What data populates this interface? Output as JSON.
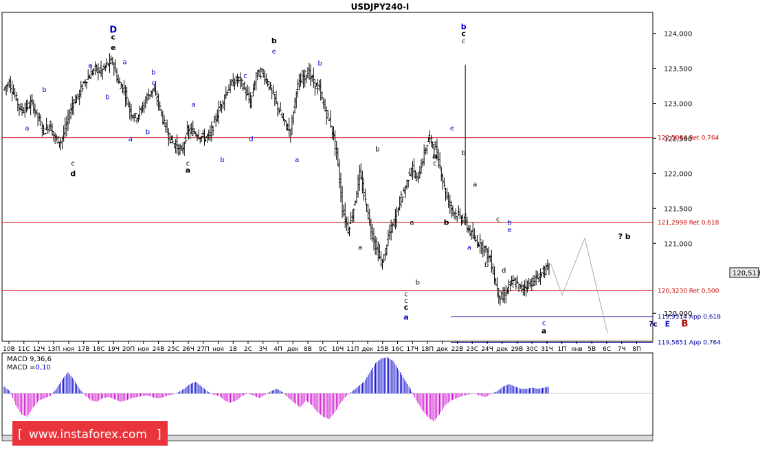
{
  "chart_data": {
    "type": "candlestick",
    "title": "USDJPY240-I",
    "ylim": [
      119.6,
      124.3
    ],
    "y_ticks": [
      "124,000",
      "123,500",
      "123,000",
      "122,500",
      "122,000",
      "121,500",
      "121,000",
      "120,000"
    ],
    "y_tick_values": [
      124.0,
      123.5,
      123.0,
      122.5,
      122.0,
      121.5,
      121.0,
      120.0
    ],
    "current_price": "120,513",
    "current_price_value": 120.513,
    "x_labels": [
      "10В",
      "11С",
      "12Ч",
      "13П",
      "ноя",
      "17В",
      "18С",
      "19Ч",
      "20П",
      "ноя",
      "24В",
      "25С",
      "26Ч",
      "27П",
      "ноя",
      "1В",
      "2С",
      "3Ч",
      "4П",
      "дек",
      "8В",
      "9С",
      "10Ч",
      "11П",
      "дек",
      "15В",
      "16С",
      "17Ч",
      "18П",
      "дек",
      "22В",
      "23С",
      "24Ч",
      "дек",
      "29В",
      "30С",
      "31Ч",
      "1П",
      "янв",
      "5В",
      "6С",
      "7Ч",
      "8П"
    ],
    "x_label_slots": [
      5,
      16,
      27,
      38,
      49,
      60,
      71,
      82,
      93,
      104,
      115,
      126,
      137,
      148,
      159,
      170,
      181,
      192,
      203,
      214,
      225,
      236,
      247,
      258,
      269,
      280,
      291,
      302,
      313,
      324,
      335,
      346,
      357,
      368,
      379,
      390,
      401,
      412,
      423,
      434,
      445,
      456,
      467
    ],
    "ohlc_note": "daily-level approximation of 4h bars",
    "series_close": [
      123.2,
      123.3,
      123.1,
      122.9,
      122.95,
      123.0,
      122.8,
      122.6,
      122.7,
      122.5,
      122.45,
      122.7,
      123.0,
      123.1,
      123.3,
      123.4,
      123.5,
      123.45,
      123.55,
      123.6,
      123.3,
      123.2,
      122.9,
      122.8,
      122.9,
      123.1,
      123.2,
      123.0,
      122.7,
      122.5,
      122.4,
      122.3,
      122.6,
      122.6,
      122.55,
      122.5,
      122.55,
      122.8,
      123.0,
      123.2,
      123.3,
      123.35,
      123.2,
      123.0,
      123.4,
      123.45,
      123.3,
      123.1,
      122.9,
      122.7,
      122.6,
      123.2,
      123.35,
      123.45,
      123.3,
      123.2,
      122.9,
      122.7,
      122.3,
      121.5,
      121.2,
      121.5,
      122.0,
      121.6,
      121.2,
      120.9,
      120.7,
      121.1,
      121.3,
      121.6,
      121.8,
      122.1,
      121.9,
      122.2,
      122.5,
      122.4,
      122.1,
      121.7,
      121.5,
      121.4,
      121.35,
      121.2,
      121.05,
      121.0,
      120.9,
      120.7,
      120.3,
      120.2,
      120.4,
      120.45,
      120.35,
      120.4,
      120.45,
      120.5,
      120.6,
      120.65
    ],
    "retracements": [
      {
        "label": "122,5084 Ret 0,764",
        "value": 122.5084
      },
      {
        "label": "121,2998 Ret 0,618",
        "value": 121.2998
      },
      {
        "label": "120,3230 Ret 0,500",
        "value": 120.323
      }
    ],
    "appreciations": [
      {
        "label": "119,9514 App 0,618",
        "value": 119.9514
      },
      {
        "label": "119,5851 App 0,764",
        "value": 119.5851
      }
    ],
    "forecast_path": [
      [
        93,
        120.55
      ],
      [
        98,
        120.2
      ],
      [
        104,
        121.0
      ],
      [
        110,
        119.65
      ]
    ],
    "macd": {
      "label_line1": "MACD 9,36,6",
      "label_line2": "MACD =",
      "value": "0,10",
      "histogram": [
        0.3,
        0.1,
        -0.5,
        -0.9,
        -1.0,
        -0.6,
        -0.3,
        -0.2,
        -0.1,
        0.2,
        0.6,
        0.9,
        0.6,
        0.2,
        -0.1,
        -0.3,
        -0.35,
        -0.2,
        -0.15,
        -0.25,
        -0.35,
        -0.3,
        -0.2,
        -0.15,
        -0.1,
        -0.1,
        -0.2,
        -0.2,
        -0.1,
        -0.05,
        0.05,
        0.2,
        0.4,
        0.5,
        0.3,
        0.1,
        -0.05,
        -0.1,
        -0.3,
        -0.4,
        -0.3,
        -0.1,
        0.0,
        -0.1,
        -0.2,
        -0.05,
        0.1,
        0.2,
        0.05,
        -0.2,
        -0.4,
        -0.6,
        -0.3,
        -0.5,
        -0.8,
        -1.0,
        -1.1,
        -0.8,
        -0.4,
        -0.1,
        0.1,
        0.3,
        0.5,
        0.9,
        1.3,
        1.5,
        1.55,
        1.4,
        1.0,
        0.6,
        0.2,
        -0.3,
        -0.7,
        -1.0,
        -1.2,
        -0.9,
        -0.5,
        -0.3,
        -0.2,
        -0.1,
        -0.05,
        0.0,
        -0.1,
        -0.15,
        0.0,
        0.1,
        0.3,
        0.4,
        0.3,
        0.2,
        0.2,
        0.25,
        0.2,
        0.25,
        0.3
      ]
    },
    "wave_labels": [
      {
        "t": "D",
        "i": 19,
        "v": 124.05,
        "c": "#0000cc",
        "s": "big"
      },
      {
        "t": "c",
        "i": 19,
        "v": 123.95,
        "c": "#000",
        "s": "bold"
      },
      {
        "t": "e",
        "i": 19,
        "v": 123.8,
        "c": "#000",
        "s": "bold"
      },
      {
        "t": "a",
        "i": 15,
        "v": 123.55,
        "c": "#0000cc",
        "s": "n"
      },
      {
        "t": "a",
        "i": 21,
        "v": 123.6,
        "c": "#0000cc",
        "s": "n"
      },
      {
        "t": "b",
        "i": 7,
        "v": 123.2,
        "c": "#0000cc",
        "s": "n"
      },
      {
        "t": "b",
        "i": 18,
        "v": 123.1,
        "c": "#0000cc",
        "s": "n"
      },
      {
        "t": "b",
        "i": 26,
        "v": 123.45,
        "c": "#0000cc",
        "s": "n"
      },
      {
        "t": "c",
        "i": 26,
        "v": 123.3,
        "c": "#0000cc",
        "s": "n"
      },
      {
        "t": "a",
        "i": 4,
        "v": 122.65,
        "c": "#0000cc",
        "s": "n"
      },
      {
        "t": "c",
        "i": 12,
        "v": 122.15,
        "c": "#000",
        "s": "n"
      },
      {
        "t": "d",
        "i": 12,
        "v": 122.0,
        "c": "#000",
        "s": "bold"
      },
      {
        "t": "a",
        "i": 22,
        "v": 122.5,
        "c": "#0000cc",
        "s": "n"
      },
      {
        "t": "b",
        "i": 25,
        "v": 122.6,
        "c": "#0000cc",
        "s": "n"
      },
      {
        "t": "a",
        "i": 33,
        "v": 122.99,
        "c": "#0000cc",
        "s": "n"
      },
      {
        "t": "c",
        "i": 32,
        "v": 122.15,
        "c": "#000",
        "s": "n"
      },
      {
        "t": "a",
        "i": 32,
        "v": 122.05,
        "c": "#000",
        "s": "bold"
      },
      {
        "t": "b",
        "i": 38,
        "v": 122.2,
        "c": "#0000cc",
        "s": "n"
      },
      {
        "t": "c",
        "i": 42,
        "v": 123.4,
        "c": "#0000cc",
        "s": "n"
      },
      {
        "t": "d",
        "i": 43,
        "v": 122.5,
        "c": "#0000cc",
        "s": "n"
      },
      {
        "t": "b",
        "i": 47,
        "v": 123.9,
        "c": "#000",
        "s": "bold"
      },
      {
        "t": "e",
        "i": 47,
        "v": 123.75,
        "c": "#0000cc",
        "s": "n"
      },
      {
        "t": "b",
        "i": 55,
        "v": 123.58,
        "c": "#0000cc",
        "s": "n"
      },
      {
        "t": "a",
        "i": 51,
        "v": 122.2,
        "c": "#0000cc",
        "s": "n"
      },
      {
        "t": "b",
        "i": 65,
        "v": 122.35,
        "c": "#000",
        "s": "n"
      },
      {
        "t": "a",
        "i": 62,
        "v": 120.95,
        "c": "#000",
        "s": "n"
      },
      {
        "t": "a",
        "i": 71,
        "v": 121.3,
        "c": "#000",
        "s": "n"
      },
      {
        "t": "c",
        "i": 70,
        "v": 120.28,
        "c": "#000",
        "s": "n"
      },
      {
        "t": "c",
        "i": 70,
        "v": 120.19,
        "c": "#000",
        "s": "n"
      },
      {
        "t": "c",
        "i": 70,
        "v": 120.09,
        "c": "#000",
        "s": "bold"
      },
      {
        "t": "a",
        "i": 70,
        "v": 119.95,
        "c": "#0000cc",
        "s": "bold"
      },
      {
        "t": "b",
        "i": 72,
        "v": 120.45,
        "c": "#000",
        "s": "n"
      },
      {
        "t": "a",
        "i": 75,
        "v": 122.25,
        "c": "#000",
        "s": "bold"
      },
      {
        "t": "c",
        "i": 75,
        "v": 122.15,
        "c": "#000",
        "s": "n"
      },
      {
        "t": "b",
        "i": 77,
        "v": 121.3,
        "c": "#000",
        "s": "bold"
      },
      {
        "t": "e",
        "i": 78,
        "v": 122.65,
        "c": "#0000cc",
        "s": "n"
      },
      {
        "t": "b",
        "i": 80,
        "v": 124.1,
        "c": "#0000cc",
        "s": "bold"
      },
      {
        "t": "c",
        "i": 80,
        "v": 124.0,
        "c": "#000",
        "s": "bold"
      },
      {
        "t": "c",
        "i": 80,
        "v": 123.9,
        "c": "#000",
        "s": "n"
      },
      {
        "t": "b",
        "i": 80,
        "v": 122.3,
        "c": "#000",
        "s": "n"
      },
      {
        "t": "a",
        "i": 82,
        "v": 121.85,
        "c": "#000",
        "s": "n"
      },
      {
        "t": "a",
        "i": 81,
        "v": 120.95,
        "c": "#0000cc",
        "s": "n"
      },
      {
        "t": "c",
        "i": 86,
        "v": 121.35,
        "c": "#000",
        "s": "n"
      },
      {
        "t": "b",
        "i": 84,
        "v": 120.7,
        "c": "#000",
        "s": "n"
      },
      {
        "t": "b",
        "i": 88,
        "v": 121.3,
        "c": "#0000cc",
        "s": "n"
      },
      {
        "t": "e",
        "i": 88,
        "v": 121.2,
        "c": "#0000cc",
        "s": "n"
      },
      {
        "t": "d",
        "i": 87,
        "v": 120.62,
        "c": "#000",
        "s": "n"
      },
      {
        "t": "c",
        "i": 94,
        "v": 119.87,
        "c": "#0000cc",
        "s": "n"
      },
      {
        "t": "a",
        "i": 94,
        "v": 119.75,
        "c": "#000",
        "s": "bold"
      },
      {
        "t": "? b",
        "i": 108,
        "v": 121.1,
        "c": "#000",
        "s": "bold"
      },
      {
        "t": "?c",
        "i": 113,
        "v": 119.85,
        "c": "#000066",
        "s": "bold"
      },
      {
        "t": "E",
        "i": 115.5,
        "v": 119.85,
        "c": "#0000cc",
        "s": "bold"
      },
      {
        "t": "B",
        "i": 118.5,
        "v": 119.85,
        "c": "#aa0000",
        "s": "big"
      }
    ]
  },
  "watermark": {
    "text": "www.instaforex.com",
    "bracket_left": "[",
    "bracket_right": "]"
  },
  "colors": {
    "ret_line": "#cc0000",
    "app_line": "#000099",
    "macd_pos": "#0000cc",
    "macd_neg": "#cc00cc",
    "forecast": "#aaaaaa"
  }
}
